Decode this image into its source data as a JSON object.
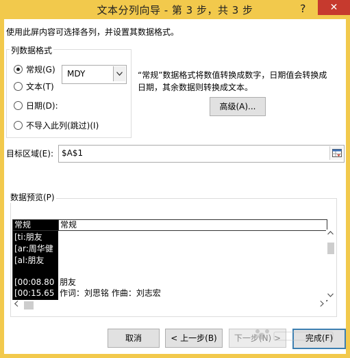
{
  "window": {
    "title": "文本分列向导 - 第 3 步，共 3 步",
    "help_label": "?",
    "close_label": "✕"
  },
  "instruction": "使用此屏内容可选择各列，并设置其数据格式。",
  "format_group": {
    "title": "列数据格式",
    "options": [
      {
        "label": "常规(G)",
        "selected": true
      },
      {
        "label": "文本(T)",
        "selected": false
      },
      {
        "label": "日期(D):",
        "selected": false
      },
      {
        "label": "不导入此列(跳过)(I)",
        "selected": false
      }
    ],
    "date_format": "MDY"
  },
  "description": "“常规”数据格式将数值转换成数字，日期值会转换成日期，其余数据则转换成文本。",
  "advanced_button": "高级(A)...",
  "destination": {
    "label": "目标区域(E):",
    "value": "$A$1"
  },
  "preview": {
    "label": "数据预览(P)",
    "headers": [
      "常规",
      "常规"
    ],
    "rows": [
      [
        "[ti:朋友",
        ""
      ],
      [
        "[ar:周华健",
        ""
      ],
      [
        "[al:朋友",
        ""
      ],
      [
        "",
        ""
      ],
      [
        "[00:08.80",
        "朋友"
      ],
      [
        "[00:15.65",
        "作词：刘思铭 作曲：刘志宏"
      ]
    ]
  },
  "buttons": {
    "cancel": "取消",
    "back": "< 上一步(B)",
    "next": "下一步(N) >",
    "finish": "完成(F)"
  },
  "watermark": "Baidu 经验"
}
